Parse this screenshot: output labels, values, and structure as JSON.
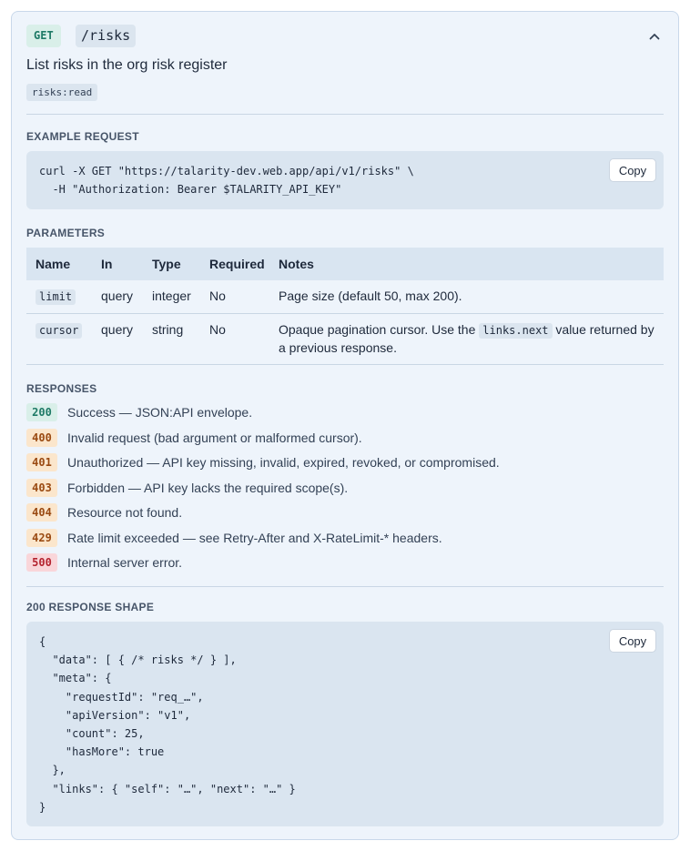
{
  "endpoint": {
    "method": "GET",
    "path": "/risks",
    "summary": "List risks in the org risk register",
    "scope": "risks:read",
    "collapse_icon": "chevron-up-icon"
  },
  "example_request": {
    "title": "EXAMPLE REQUEST",
    "code": "curl -X GET \"https://talarity-dev.web.app/api/v1/risks\" \\\n  -H \"Authorization: Bearer $TALARITY_API_KEY\"",
    "copy_label": "Copy"
  },
  "parameters": {
    "title": "PARAMETERS",
    "columns": [
      "Name",
      "In",
      "Type",
      "Required",
      "Notes"
    ],
    "rows": [
      {
        "name": "limit",
        "in": "query",
        "type": "integer",
        "required": "No",
        "notes": "Page size (default 50, max 200)."
      },
      {
        "name": "cursor",
        "in": "query",
        "type": "string",
        "required": "No",
        "notes_before": "Opaque pagination cursor. Use the ",
        "notes_code": "links.next",
        "notes_after": " value returned by a previous response."
      }
    ]
  },
  "responses": {
    "title": "RESPONSES",
    "items": [
      {
        "code": "200",
        "description": "Success — JSON:API envelope.",
        "status": "success"
      },
      {
        "code": "400",
        "description": "Invalid request (bad argument or malformed cursor).",
        "status": "warning"
      },
      {
        "code": "401",
        "description": "Unauthorized — API key missing, invalid, expired, revoked, or compromised.",
        "status": "warning"
      },
      {
        "code": "403",
        "description": "Forbidden — API key lacks the required scope(s).",
        "status": "warning"
      },
      {
        "code": "404",
        "description": "Resource not found.",
        "status": "warning"
      },
      {
        "code": "429",
        "description": "Rate limit exceeded — see Retry-After and X-RateLimit-* headers.",
        "status": "warning"
      },
      {
        "code": "500",
        "description": "Internal server error.",
        "status": "error"
      }
    ]
  },
  "response_shape": {
    "title": "200 RESPONSE SHAPE",
    "code": "{\n  \"data\": [ { /* risks */ } ],\n  \"meta\": {\n    \"requestId\": \"req_…\",\n    \"apiVersion\": \"v1\",\n    \"count\": 25,\n    \"hasMore\": true\n  },\n  \"links\": { \"self\": \"…\", \"next\": \"…\" }\n}",
    "copy_label": "Copy"
  },
  "colors": {
    "success_bg": "#d9efe9",
    "success_fg": "#1e7a66",
    "warning_bg": "#fbe6cc",
    "warning_fg": "#9a4a12",
    "error_bg": "#f9d6da",
    "error_fg": "#b4232f"
  }
}
